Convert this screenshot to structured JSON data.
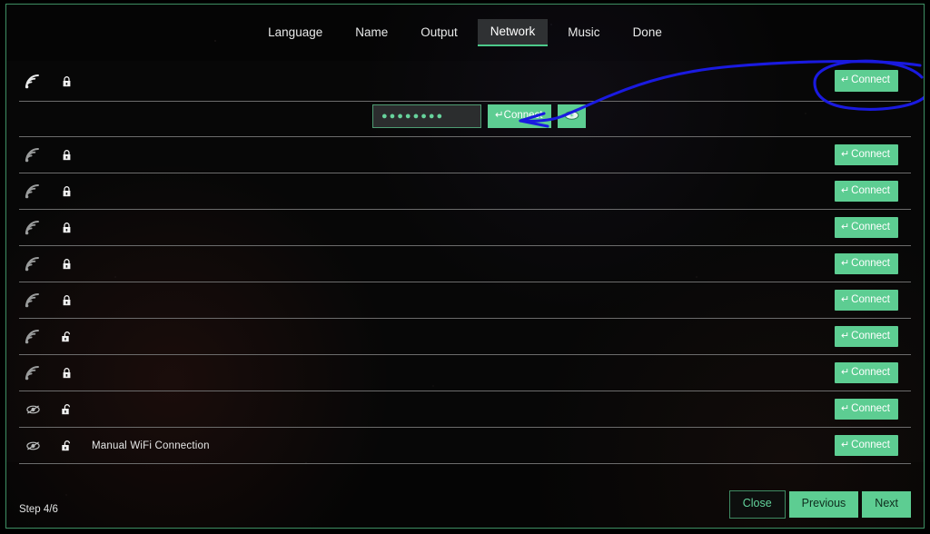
{
  "window": {
    "border_color": "#3e8f63",
    "background_color": "#050505"
  },
  "tabs": {
    "items": [
      {
        "label": "Language",
        "active": false
      },
      {
        "label": "Name",
        "active": false
      },
      {
        "label": "Output",
        "active": false
      },
      {
        "label": "Network",
        "active": true
      },
      {
        "label": "Music",
        "active": false
      },
      {
        "label": "Done",
        "active": false
      }
    ],
    "active_accent": "#4cc98a",
    "active_background": "#2f3133"
  },
  "network_list": {
    "connect_label": "Connect",
    "connect_glyph": "↵",
    "connect_color": "#5dcd92",
    "rows": [
      {
        "icon": "wifi-signal-icon",
        "lock": "lock-closed-icon",
        "ssid": "",
        "redacted": true,
        "redaction_color": "#e01b1b",
        "redaction_width": 54,
        "selected": true
      },
      {
        "icon": "wifi-signal-icon",
        "lock": "lock-closed-icon",
        "ssid": "",
        "redacted": true,
        "redaction_color": "#1414d8",
        "redaction_width": 78,
        "selected": false
      },
      {
        "icon": "wifi-signal-icon",
        "lock": "lock-closed-icon",
        "ssid": "",
        "redacted": true,
        "redaction_color": "#1414d8",
        "redaction_width": 68,
        "selected": false
      },
      {
        "icon": "wifi-signal-icon",
        "lock": "lock-closed-icon",
        "ssid": "",
        "redacted": true,
        "redaction_color": "#1414d8",
        "redaction_width": 128,
        "selected": false
      },
      {
        "icon": "wifi-signal-icon",
        "lock": "lock-closed-icon",
        "ssid": "",
        "redacted": true,
        "redaction_color": "#1414d8",
        "redaction_width": 56,
        "selected": false
      },
      {
        "icon": "wifi-signal-icon",
        "lock": "lock-closed-icon",
        "ssid": "",
        "redacted": true,
        "redaction_color": "#1414d8",
        "redaction_width": 34,
        "selected": false
      },
      {
        "icon": "wifi-signal-icon",
        "lock": "lock-open-icon",
        "ssid": "",
        "redacted": true,
        "redaction_color": "#1414d8",
        "redaction_width": 48,
        "selected": false
      },
      {
        "icon": "wifi-signal-icon",
        "lock": "lock-closed-icon",
        "ssid": "",
        "redacted": true,
        "redaction_color": "#1414d8",
        "redaction_width": 30,
        "selected": false
      },
      {
        "icon": "eye-hidden-icon",
        "lock": "lock-open-icon",
        "ssid": "",
        "redacted": false,
        "selected": false
      },
      {
        "icon": "eye-hidden-icon",
        "lock": "lock-open-icon",
        "ssid": "Manual WiFi Connection",
        "redacted": false,
        "selected": false
      }
    ]
  },
  "password_row": {
    "input_value": "●●●●●●●●",
    "input_placeholder": "",
    "connect_label": "Connect",
    "connect_glyph": "↵",
    "show_password_icon": "eye-icon",
    "input_border_color": "#4e9c72"
  },
  "footer": {
    "step_text": "Step 4/6",
    "close_label": "Close",
    "previous_label": "Previous",
    "next_label": "Next",
    "accent_color": "#5dcd92"
  },
  "annotations": {
    "ellipse_color": "#1a1ae0",
    "arrow_color": "#1a1ae0",
    "ellipse_target": "first-row-connect-button",
    "arrow_target": "show-password-eye-button"
  }
}
